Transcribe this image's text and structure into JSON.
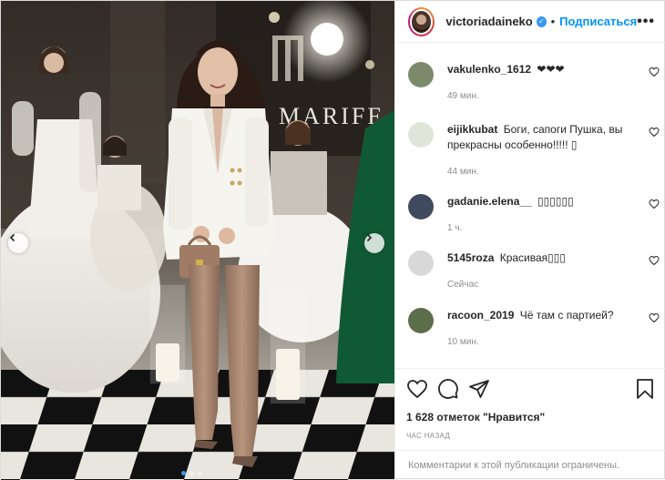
{
  "post": {
    "author": "victoriadaineko",
    "follow_label": "Подписаться",
    "separator": "•",
    "more_label": "•••",
    "backdrop_sign": "MARIFF",
    "likes_text": "1 628 отметок \"Нравится\"",
    "time_text": "ЧАС НАЗАД",
    "comments_limited": "Комментарии к этой публикации ограничены.",
    "carousel": {
      "total": 3,
      "active": 1
    },
    "accent_color": "#0095f6"
  },
  "comments": [
    {
      "user": "vakulenko_1612",
      "text": "❤❤❤",
      "time": "49 мин.",
      "avatar_color": "#7a8a6b"
    },
    {
      "user": "eijikkubat",
      "text": "Боги, сапоги Пушка, вы прекрасны особенно!!!!! ▯",
      "time": "44 мин.",
      "avatar_color": "#dfe6d8"
    },
    {
      "user": "gadanie.elena__",
      "text": "▯▯▯▯▯▯",
      "time": "1 ч.",
      "avatar_color": "#3f4a5e"
    },
    {
      "user": "5145roza",
      "text": "Красивая▯▯▯",
      "time": "Сейчас",
      "avatar_color": "#d8d8d8"
    },
    {
      "user": "racoon_2019",
      "text": "Чё там с партией?",
      "time": "10 мин.",
      "avatar_color": "#5c6e4a"
    }
  ]
}
